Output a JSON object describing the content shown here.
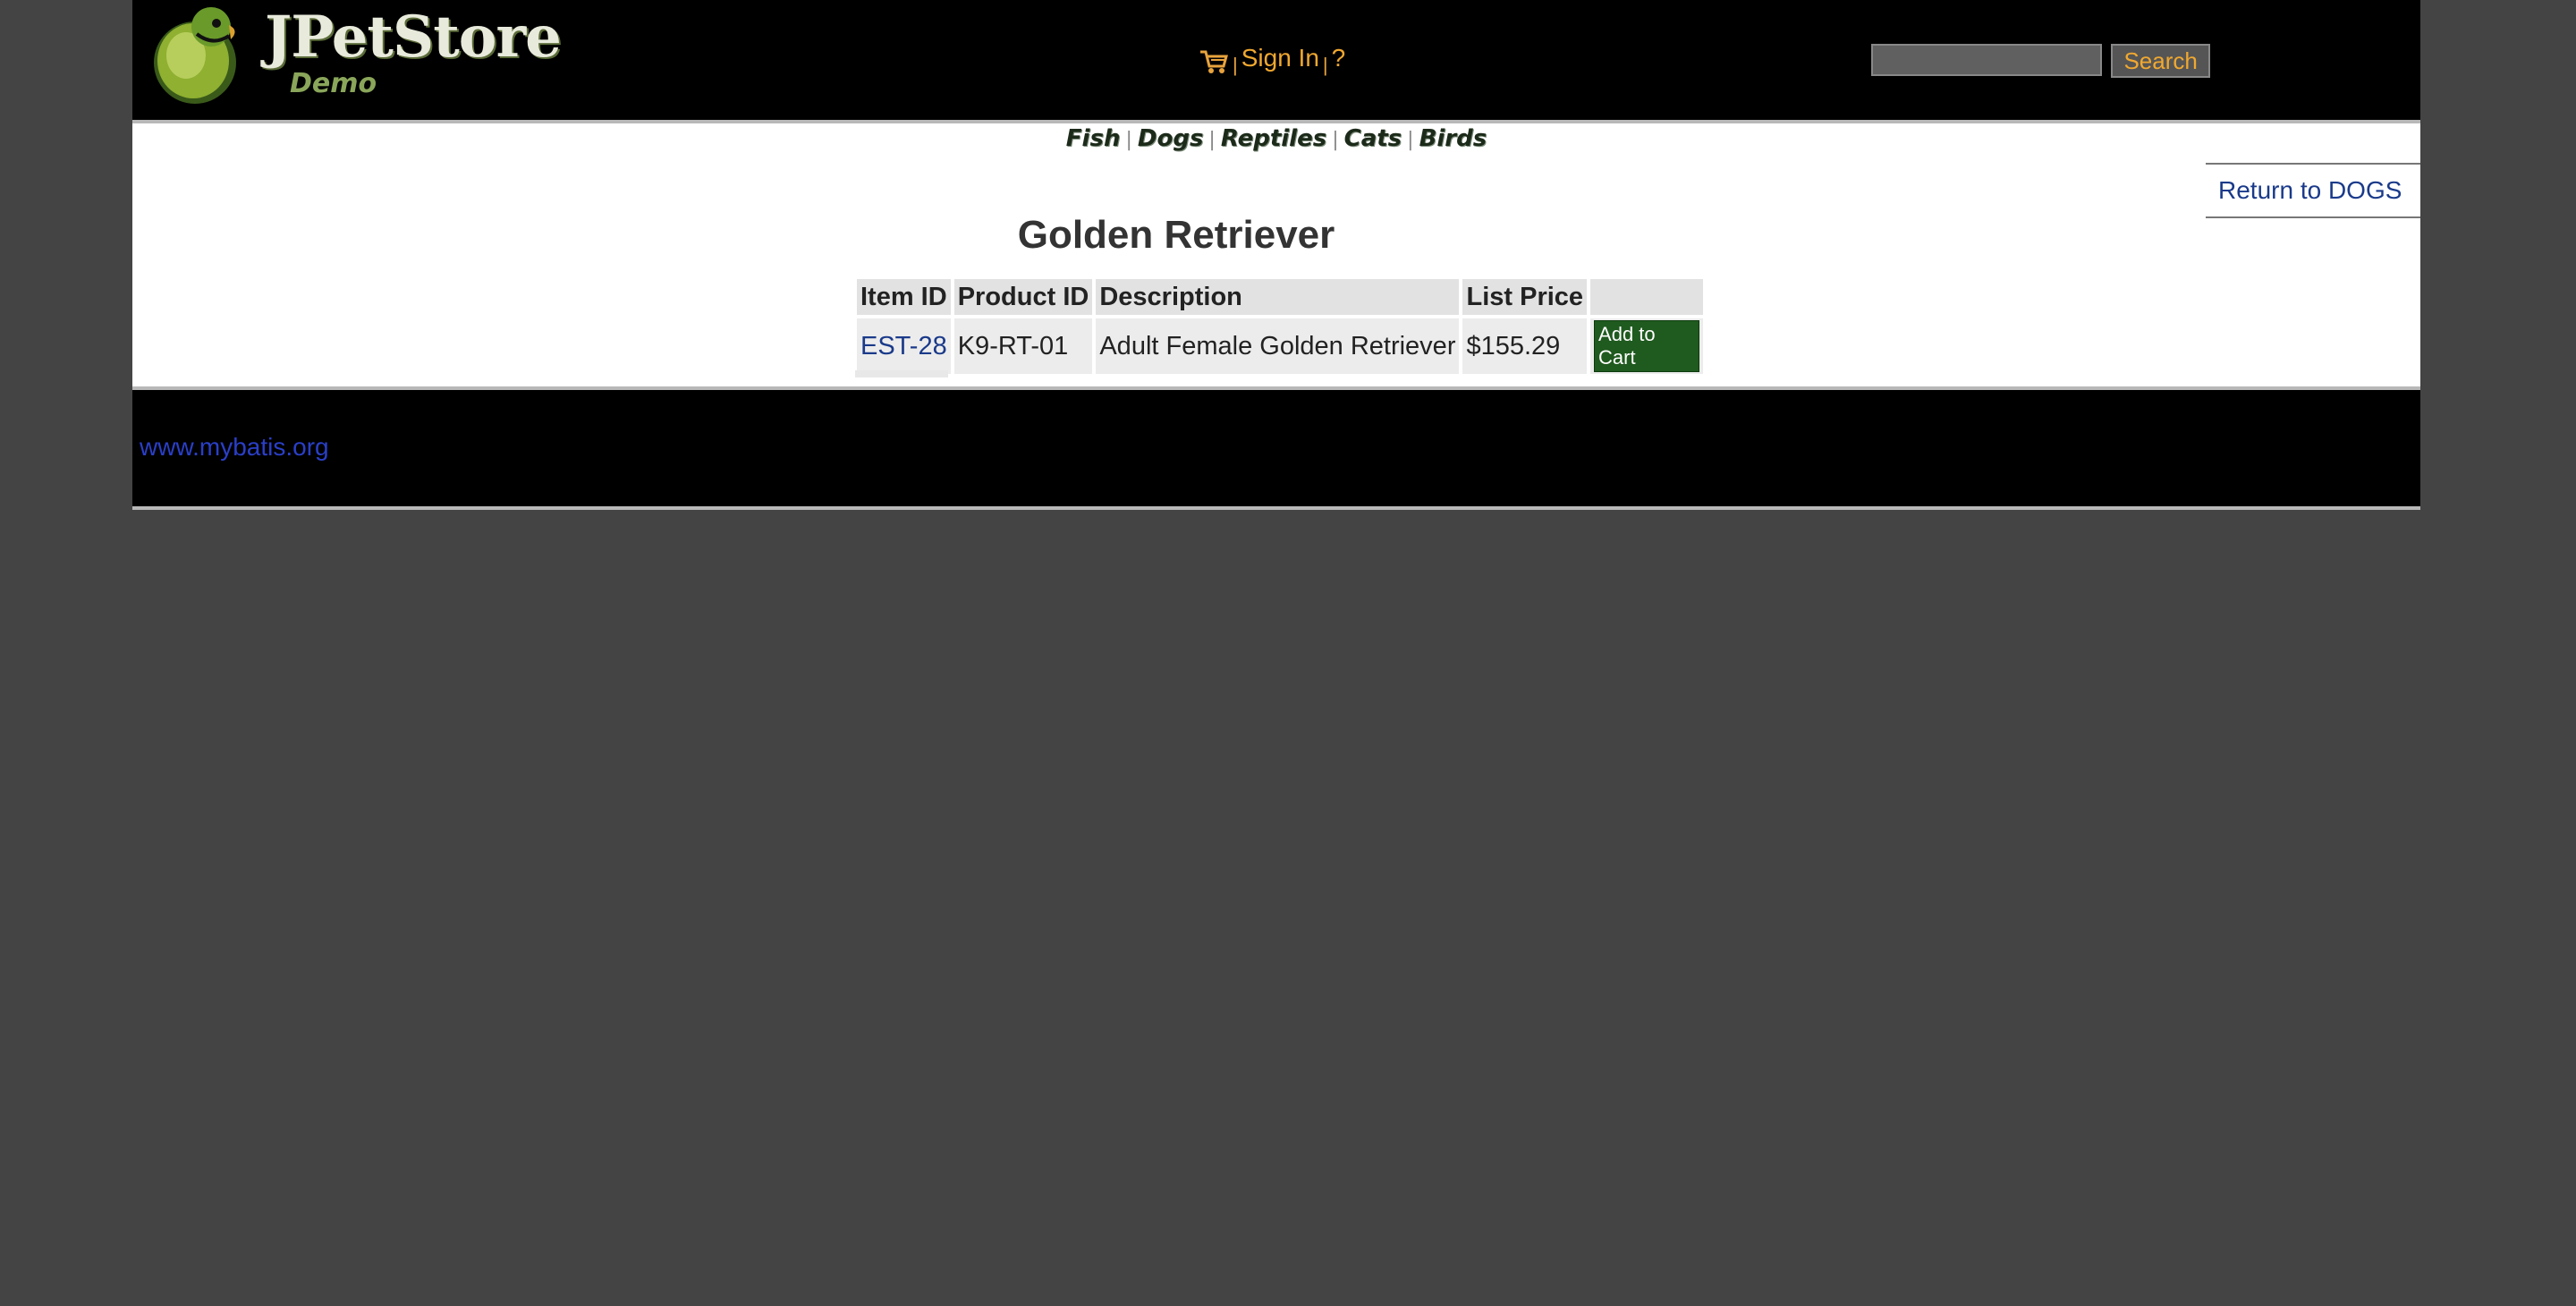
{
  "header": {
    "logo_title": "JPetStore",
    "logo_subtitle": "Demo",
    "menu": {
      "sign_in": "Sign In",
      "help": "?",
      "separator": "|"
    },
    "search": {
      "value": "",
      "button": "Search"
    }
  },
  "quicklinks": [
    "Fish",
    "Dogs",
    "Reptiles",
    "Cats",
    "Birds"
  ],
  "quicklink_separator": "|",
  "return_link": "Return to DOGS",
  "product": {
    "name": "Golden Retriever",
    "columns": [
      "Item ID",
      "Product ID",
      "Description",
      "List Price",
      ""
    ],
    "rows": [
      {
        "item_id": "EST-28",
        "product_id": "K9-RT-01",
        "description": "Adult Female Golden Retriever",
        "price": "$155.29",
        "action": "Add to Cart"
      }
    ]
  },
  "footer": {
    "link": "www.mybatis.org"
  },
  "colors": {
    "background": "#444444",
    "header": "#000000",
    "menu_accent": "#f0a830",
    "link": "#1a3a8a",
    "add_to_cart": "#1f5a1f"
  }
}
